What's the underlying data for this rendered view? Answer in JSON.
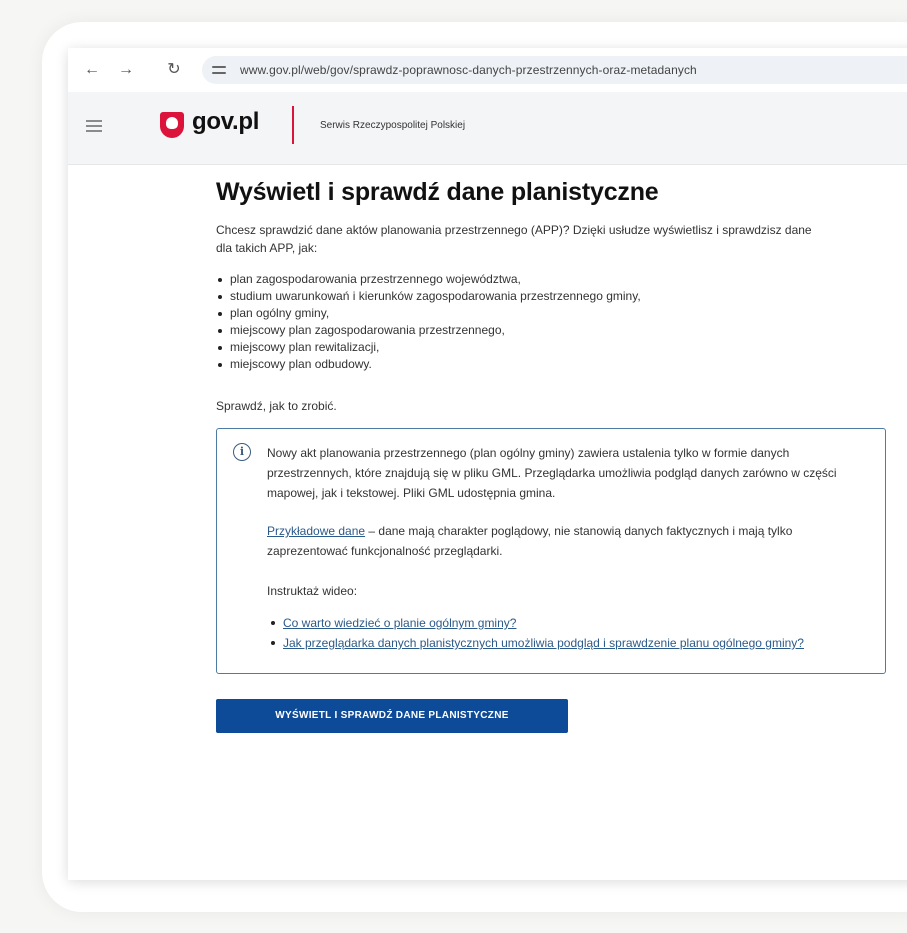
{
  "browser": {
    "url": "www.gov.pl/web/gov/sprawdz-poprawnosc-danych-przestrzennych-oraz-metadanych",
    "back_icon": "arrow-left",
    "forward_icon": "arrow-right",
    "reload_icon": "reload"
  },
  "header": {
    "logo_text": "gov.pl",
    "subtitle": "Serwis Rzeczypospolitej Polskiej",
    "brand_color": "#dc143c"
  },
  "main": {
    "title": "Wyświetl i sprawdź dane planistyczne",
    "intro": "Chcesz sprawdzić dane aktów planowania przestrzennego (APP)? Dzięki usłudze wyświetlisz i sprawdzisz dane dla takich APP, jak:",
    "plan_types": [
      "plan zagospodarowania przestrzennego województwa,",
      "studium uwarunkowań i kierunków zagospodarowania przestrzennego gminy,",
      "plan ogólny gminy,",
      "miejscowy plan zagospodarowania przestrzennego,",
      "miejscowy plan rewitalizacji,",
      "miejscowy plan odbudowy."
    ],
    "howto": "Sprawdź, jak to zrobić.",
    "info": {
      "paragraph1": "Nowy akt planowania przestrzennego (plan ogólny gminy) zawiera ustalenia tylko w formie danych przestrzennych, które znajdują się w pliku GML. Przeglądarka umożliwia podgląd danych zarówno w części mapowej, jak i tekstowej. Pliki GML udostępnia gmina.",
      "sample_link": "Przykładowe dane",
      "sample_text": " – dane mają charakter poglądowy, nie stanowią danych faktycznych i mają tylko zaprezentować funkcjonalność przeglądarki.",
      "video_heading": "Instruktaż wideo:",
      "video_links": [
        "Co warto wiedzieć o planie ogólnym gminy?",
        "Jak przeglądarka danych planistycznych umożliwia podgląd i sprawdzenie planu ogólnego gminy?"
      ]
    },
    "cta_label": "WYŚWIETL I SPRAWDŹ DANE PLANISTYCZNE"
  }
}
